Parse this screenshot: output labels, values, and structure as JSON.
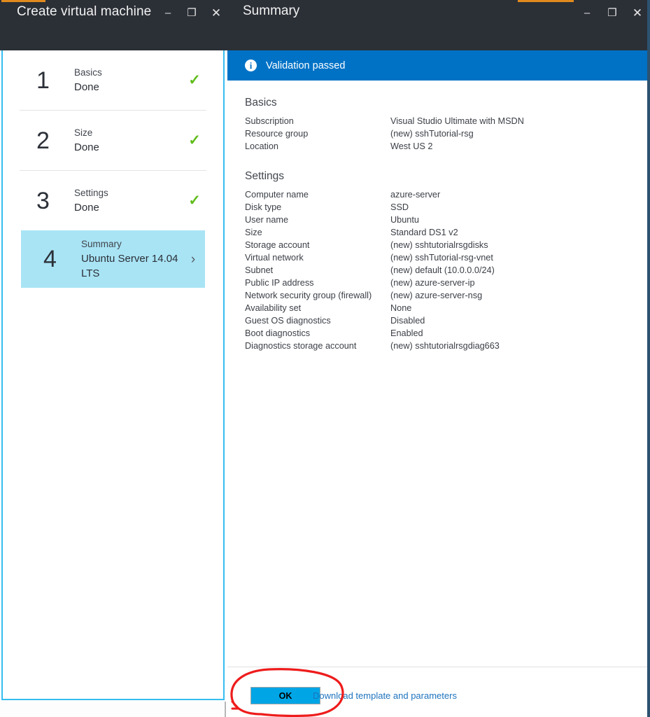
{
  "left_window": {
    "title": "Create virtual machine",
    "accent_color": "#e08a1e",
    "controls": {
      "minimize": "–",
      "maximize": "❐",
      "close": "✕"
    },
    "steps": [
      {
        "number": "1",
        "title": "Basics",
        "subtitle": "Done",
        "status_icon": "check-icon",
        "state": "done"
      },
      {
        "number": "2",
        "title": "Size",
        "subtitle": "Done",
        "status_icon": "check-icon",
        "state": "done"
      },
      {
        "number": "3",
        "title": "Settings",
        "subtitle": "Done",
        "status_icon": "check-icon",
        "state": "done"
      },
      {
        "number": "4",
        "title": "Summary",
        "subtitle": "Ubuntu Server 14.04 LTS",
        "status_icon": "chevron-right-icon",
        "state": "active"
      }
    ],
    "check_glyph": "✓",
    "chevron_glyph": "›",
    "check_color": "#60bd1b",
    "active_bg": "#a9e4f5",
    "border_color": "#35bdf0"
  },
  "right_window": {
    "title": "Summary",
    "accent_color": "#e08a1e",
    "controls": {
      "minimize": "–",
      "maximize": "❐",
      "close": "✕"
    },
    "validation": {
      "icon": "info-icon",
      "icon_glyph": "i",
      "text": "Validation passed",
      "bg_color": "#0072c6"
    },
    "sections": [
      {
        "title": "Basics",
        "rows": [
          {
            "key": "Subscription",
            "value": "Visual Studio Ultimate with MSDN"
          },
          {
            "key": "Resource group",
            "value": "(new) sshTutorial-rsg"
          },
          {
            "key": "Location",
            "value": "West US 2"
          }
        ]
      },
      {
        "title": "Settings",
        "rows": [
          {
            "key": "Computer name",
            "value": "azure-server"
          },
          {
            "key": "Disk type",
            "value": "SSD"
          },
          {
            "key": "User name",
            "value": "Ubuntu"
          },
          {
            "key": "Size",
            "value": "Standard DS1 v2"
          },
          {
            "key": "Storage account",
            "value": "(new) sshtutorialrsgdisks"
          },
          {
            "key": "Virtual network",
            "value": "(new) sshTutorial-rsg-vnet"
          },
          {
            "key": "Subnet",
            "value": "(new) default (10.0.0.0/24)"
          },
          {
            "key": "Public IP address",
            "value": "(new) azure-server-ip"
          },
          {
            "key": "Network security group (firewall)",
            "value": "(new) azure-server-nsg"
          },
          {
            "key": "Availability set",
            "value": "None"
          },
          {
            "key": "Guest OS diagnostics",
            "value": "Disabled"
          },
          {
            "key": "Boot diagnostics",
            "value": "Enabled"
          },
          {
            "key": "Diagnostics storage account",
            "value": "(new) sshtutorialrsgdiag663"
          }
        ]
      }
    ],
    "footer": {
      "ok_label": "OK",
      "ok_color": "#00a5e6",
      "download_label": "Download template and parameters",
      "link_color": "#1e73be"
    }
  },
  "annotation": {
    "shape": "red-ellipse-highlight",
    "color": "#ee1c1c",
    "target": "ok-button"
  }
}
